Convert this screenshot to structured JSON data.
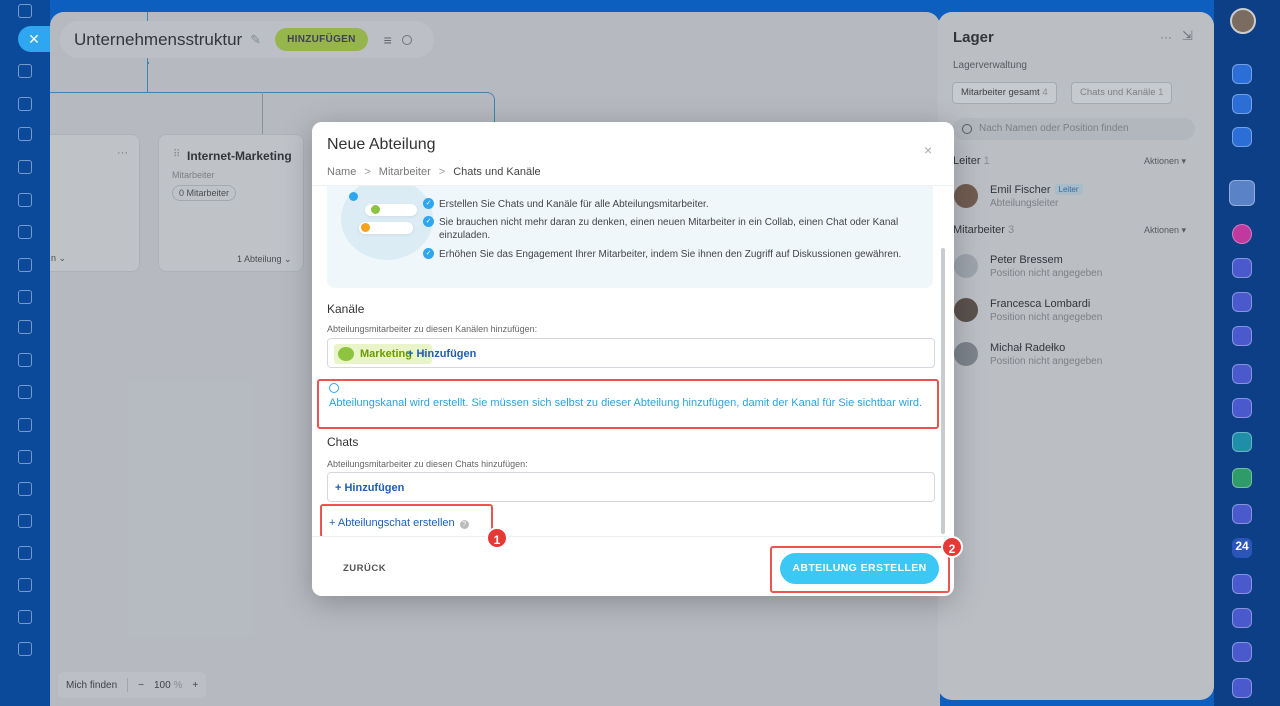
{
  "canvas": {
    "title": "Unternehmensstruktur",
    "add_label": "HINZUFÜGEN",
    "card_left_foot": "n",
    "card": {
      "title": "Internet-Marketing",
      "sub": "Mitarbeiter",
      "pill": "0 Mitarbeiter",
      "foot": "1 Abteilung"
    },
    "bottom": {
      "find_me": "Mich finden",
      "zoom_minus": "−",
      "zoom_level": "100",
      "zoom_unit": "%",
      "zoom_plus": "+"
    }
  },
  "right_panel": {
    "title": "Lager",
    "subtitle": "Lagerverwaltung",
    "tabs": [
      {
        "label": "Mitarbeiter gesamt",
        "count": "4"
      },
      {
        "label": "Chats und Kanäle",
        "count": "1"
      }
    ],
    "search_placeholder": "Nach Namen oder Position finden",
    "head_section": {
      "label": "Leiter",
      "count": "1",
      "action": "Aktionen"
    },
    "head_person": {
      "name": "Emil Fischer",
      "badge": "Leiter",
      "position": "Abteilungsleiter"
    },
    "employees_section": {
      "label": "Mitarbeiter",
      "count": "3",
      "action": "Aktionen"
    },
    "employees": [
      {
        "name": "Peter Bressem",
        "position": "Position nicht angegeben"
      },
      {
        "name": "Francesca Lombardi",
        "position": "Position nicht angegeben"
      },
      {
        "name": "Michał Radełko",
        "position": "Position nicht angegeben"
      }
    ]
  },
  "modal": {
    "title": "Neue Abteilung",
    "breadcrumb": [
      "Name",
      "Mitarbeiter",
      "Chats und Kanäle"
    ],
    "promo_items": [
      "Erstellen Sie Chats und Kanäle für alle Abteilungsmitarbeiter.",
      "Sie brauchen nicht mehr daran zu denken, einen neuen Mitarbeiter in ein Collab, einen Chat oder Kanal einzuladen.",
      "Erhöhen Sie das Engagement Ihrer Mitarbeiter, indem Sie ihnen den Zugriff auf Diskussionen gewähren."
    ],
    "channels": {
      "title": "Kanäle",
      "hint": "Abteilungsmitarbeiter zu diesen Kanälen hinzufügen:",
      "tag": "Marketing",
      "add": "+ Hinzufügen"
    },
    "notice": "Abteilungskanal wird erstellt. Sie müssen sich selbst zu dieser Abteilung hinzufügen, damit der Kanal für Sie sichtbar wird.",
    "chats": {
      "title": "Chats",
      "hint": "Abteilungsmitarbeiter zu diesen Chats hinzufügen:",
      "add": "+ Hinzufügen"
    },
    "create_chat": "+ Abteilungschat erstellen",
    "back": "ZURÜCK",
    "create": "ABTEILUNG ERSTELLEN"
  },
  "markers": [
    "1",
    "2"
  ],
  "sidebar": {
    "counter_label": "24"
  },
  "colors": {
    "accent": "#3bc8f5",
    "highlight": "#ef5350",
    "add_pill": "#bde34e",
    "link": "#1e5fb3"
  }
}
